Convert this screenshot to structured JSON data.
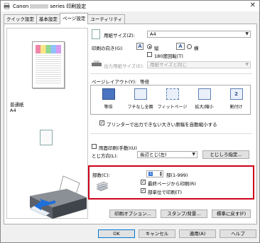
{
  "window": {
    "title_prefix": "Canon",
    "title_suffix": "series 印刷設定"
  },
  "tabs": [
    {
      "label": "クイック設定"
    },
    {
      "label": "基本設定"
    },
    {
      "label": "ページ設定",
      "active": true
    },
    {
      "label": "ユーティリティ"
    }
  ],
  "preview": {
    "media_line1": "普通紙",
    "media_line2": "A4"
  },
  "page_size": {
    "label": "用紙サイズ(Z):",
    "value": "A4"
  },
  "orientation": {
    "label": "印刷の向き(G):",
    "portrait_label": "縦",
    "landscape_label": "横",
    "rotate_label": "180度回転(T)",
    "portrait_checked": true,
    "rotate_checked": false
  },
  "output_size": {
    "label": "出力用紙サイズ(E):",
    "value": "用紙サイズと同じ"
  },
  "page_layout": {
    "label": "ページレイアウト(Y):",
    "selected": "等倍",
    "items": [
      {
        "label": "等倍"
      },
      {
        "label": "フチなし全面"
      },
      {
        "label": "フィットページ"
      },
      {
        "label": "拡大/縮小"
      },
      {
        "label": "割付け"
      }
    ]
  },
  "auto_reduce": {
    "label": "プリンターで出力できない大きい原稿を自動縮小する",
    "checked": true
  },
  "duplex": {
    "label": "両面印刷(手動)(U)",
    "checked": false
  },
  "binding": {
    "label": "とじ方向(L):",
    "value": "長辺とじ(左)",
    "margin_button": "とじしろ指定..."
  },
  "copies": {
    "label": "部数(C):",
    "value": "1",
    "range": "部(1-999)",
    "last_page_label": "最終ページから印刷(R)",
    "last_page_checked": true,
    "collate_label": "部単位で印刷(T)",
    "collate_checked": true
  },
  "buttons": {
    "print_options": "印刷オプション...",
    "stamp_background": "スタンプ/背景...",
    "defaults": "標準に戻す(F)",
    "ok": "OK",
    "cancel": "キャンセル",
    "apply": "適用(A)",
    "help": "ヘルプ"
  }
}
